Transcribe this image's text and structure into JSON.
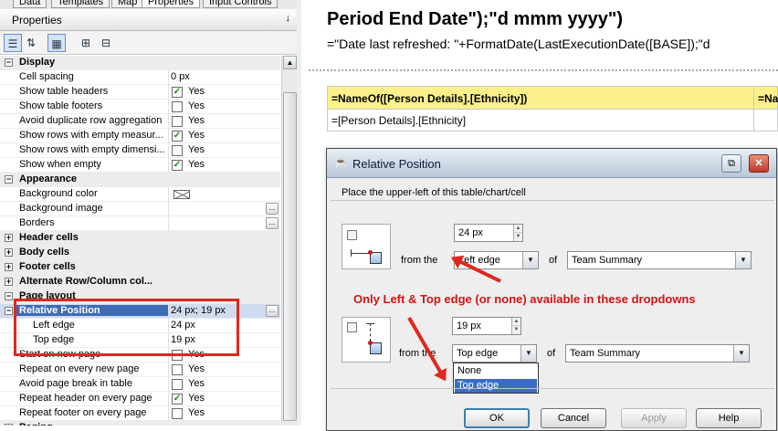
{
  "panel": {
    "tabs": [
      "Data",
      "Templates",
      "Map",
      "Properties",
      "Input Controls"
    ],
    "title": "Properties",
    "pin": "↓"
  },
  "toolbar_icons": [
    "categorized-view-icon",
    "sort-alpha-icon",
    "table-view-icon",
    "expand-all-icon",
    "collapse-all-icon"
  ],
  "properties": [
    {
      "type": "group",
      "label": "Display",
      "expanded": true
    },
    {
      "type": "text",
      "label": "Cell spacing",
      "value": "0 px"
    },
    {
      "type": "check",
      "label": "Show table headers",
      "checked": true,
      "value": "Yes"
    },
    {
      "type": "check",
      "label": "Show table footers",
      "checked": false,
      "value": "Yes"
    },
    {
      "type": "check",
      "label": "Avoid duplicate row aggregation",
      "checked": false,
      "value": "Yes"
    },
    {
      "type": "check",
      "label": "Show rows with empty measur...",
      "checked": true,
      "value": "Yes"
    },
    {
      "type": "check",
      "label": "Show rows with empty dimensi...",
      "checked": false,
      "value": "Yes"
    },
    {
      "type": "check",
      "label": "Show when empty",
      "checked": true,
      "value": "Yes"
    },
    {
      "type": "group",
      "label": "Appearance",
      "expanded": true
    },
    {
      "type": "color",
      "label": "Background color",
      "value": ""
    },
    {
      "type": "dots",
      "label": "Background image",
      "value": ""
    },
    {
      "type": "dots",
      "label": "Borders",
      "value": ""
    },
    {
      "type": "group",
      "label": "Header cells",
      "expanded": false
    },
    {
      "type": "group",
      "label": "Body cells",
      "expanded": false
    },
    {
      "type": "group",
      "label": "Footer cells",
      "expanded": false
    },
    {
      "type": "group",
      "label": "Alternate Row/Column col...",
      "expanded": false
    },
    {
      "type": "group",
      "label": "Page layout",
      "expanded": true
    },
    {
      "type": "selected",
      "label": "Relative Position",
      "value": "24 px; 19 px",
      "expanded": true
    },
    {
      "type": "child",
      "label": "Left edge",
      "value": "24 px"
    },
    {
      "type": "child",
      "label": "Top edge",
      "value": "19 px"
    },
    {
      "type": "check",
      "label": "Start on new page",
      "checked": false,
      "value": "Yes"
    },
    {
      "type": "check",
      "label": "Repeat on every new page",
      "checked": false,
      "value": "Yes"
    },
    {
      "type": "check",
      "label": "Avoid page break in table",
      "checked": false,
      "value": "Yes"
    },
    {
      "type": "check",
      "label": "Repeat header on every page",
      "checked": true,
      "value": "Yes"
    },
    {
      "type": "check",
      "label": "Repeat footer on every page",
      "checked": false,
      "value": "Yes"
    },
    {
      "type": "group",
      "label": "Paging",
      "expanded": false
    }
  ],
  "document": {
    "title": "Period End Date\");\"d mmm yyyy\")",
    "subtitle": "=\"Date last refreshed: \"+FormatDate(LastExecutionDate([BASE]);\"d",
    "table_header": "=NameOf([Person Details].[Ethnicity])",
    "table_header_2": "=Nam",
    "table_cell": "=[Person Details].[Ethnicity]"
  },
  "dialog": {
    "title": "Relative Position",
    "instruction": "Place the upper-left of this table/chart/cell",
    "left": {
      "value": "24 px",
      "from_label": "from the",
      "edge": "Left edge",
      "of_label": "of",
      "target": "Team Summary"
    },
    "top": {
      "value": "19 px",
      "from_label": "from the",
      "edge": "Top edge",
      "of_label": "of",
      "target": "Team Summary"
    },
    "dropdown_options": [
      "None",
      "Top edge"
    ],
    "dropdown_highlighted": "Top edge",
    "buttons": {
      "ok": "OK",
      "cancel": "Cancel",
      "apply": "Apply",
      "help": "Help"
    }
  },
  "annotation": {
    "note": "Only Left & Top edge (or none) available in these dropdowns",
    "color": "#e0281e"
  }
}
